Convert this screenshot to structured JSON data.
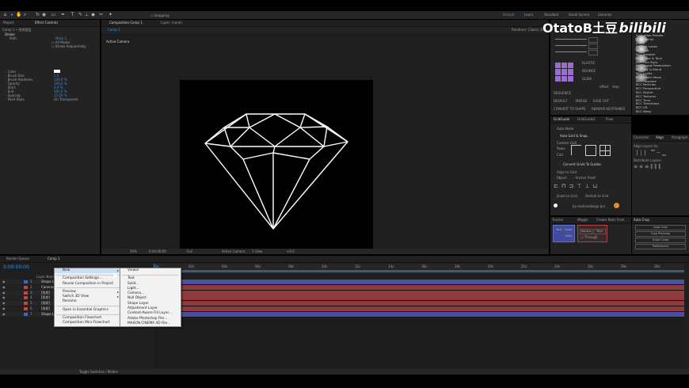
{
  "toolbar": {
    "snapping_label": "Snapping",
    "workspaces": [
      "Default",
      "Learn",
      "Standard",
      "Small Screen",
      "Libraries"
    ]
  },
  "project_panel": {
    "tab_project": "Project",
    "tab_effect_controls": "Effect Controls",
    "comp_label": "Comp 1 • 形状图层",
    "effect_name": "Stroke",
    "paint_label": "Path",
    "mask_value": "Mask 1",
    "all_masks": "All Masks",
    "stroke_sequentially": "Stroke Sequentially",
    "props": [
      {
        "name": "Color",
        "value": ""
      },
      {
        "name": "Brush Size",
        "value": "2.0"
      },
      {
        "name": "Brush Hardness",
        "value": "100.0 %"
      },
      {
        "name": "Opacity",
        "value": "100.0 %"
      },
      {
        "name": "Start",
        "value": "0.0 %"
      },
      {
        "name": "End",
        "value": "100.0 %"
      },
      {
        "name": "Spacing",
        "value": "15.00 %"
      },
      {
        "name": "Paint Style",
        "value": "On Transparent"
      }
    ]
  },
  "viewer": {
    "tab_comp": "Composition Comp 1",
    "layer_label": "Layer: (none)",
    "sub_tab": "Comp 1",
    "active_camera": "Active Camera",
    "renderer_label": "Renderer:",
    "renderer_value": "Classic 3D",
    "zoom": "50%",
    "timecode": "0:00:00:00",
    "quality": "Full",
    "view": "Active Camera",
    "views": "1 View",
    "offset": "+0.0"
  },
  "watermark": {
    "text": "OtatoB土豆",
    "logo": "bilibili"
  },
  "right_panel": {
    "effects_list": [
      "Animation Presets",
      "3D Channel",
      "Audio",
      "BCC Art Looks",
      "BCC Blur",
      "BCC Browser",
      "BCC Color & Tone",
      "BCC Film Style",
      "BCC Image Restoration",
      "BCC Key & Blend",
      "BCC Lights",
      "BCC Match Move",
      "BCC Obsolete",
      "BCC Particles",
      "BCC Perspective",
      "BCC Stylize",
      "BCC Textures",
      "BCC Time",
      "BCC Transitions",
      "BCC VR",
      "BCC Warp"
    ],
    "tool_labels": {
      "elastic": "ELASTIC",
      "bounce": "BOUNCE",
      "glide": "GLIDE",
      "sequence": "SEQUENCE",
      "default": "DEFAULT",
      "merge": "MERGE",
      "ease_in": "EASE IN",
      "ease_out": "EASE OUT",
      "convert": "CONVERT TO SHAPE",
      "remove": "REMOVE KEYFRAMES",
      "offset": "offset",
      "step": "step"
    },
    "grid_tabs": [
      "GridGuide",
      "GridGuide2",
      "Flow"
    ],
    "grid": {
      "auto_mode": "Auto Mode",
      "auto_grid": "Auto Grid & Snap",
      "custom_grid": "Custom Grid",
      "rows": "Rows",
      "cols": "Cols",
      "convert_grids": "Convert Grids To Guides",
      "align_to_grid": "Align to Grid",
      "object_label": "Object",
      "anchor_point": "Anchor Point",
      "scale_to_grid": "Scale to Grid",
      "stretch_to_grid": "Stretch to Grid",
      "by": "by motiondesign.pro"
    },
    "character_tabs": [
      "Character",
      "Align",
      "Paragraph"
    ],
    "align_label": "Align Layers to:",
    "distribute_label": "Distribute Layers:",
    "tracker_tabs": [
      "Tracker",
      "Wiggle",
      "Create Nulls From"
    ],
    "tracker_buttons": [
      "Null",
      "Layer",
      "Solid",
      "Source",
      "Find"
    ],
    "through_label": "Through",
    "auto_crop_tab": "Auto Crop",
    "auto_crop_buttons": [
      "Auto Crop",
      "Crop Precomp",
      "Scale Comp",
      "Preferences"
    ]
  },
  "timeline": {
    "render_queue_tab": "Render Queue",
    "comp_tab": "Comp 1",
    "timecode": "0:00:00:00",
    "layer_header": "Layer Name",
    "layers": [
      {
        "num": "1",
        "name": "Shape L",
        "color": "#3a6bb8"
      },
      {
        "num": "2",
        "name": "Camera",
        "color": "#b84a4a"
      },
      {
        "num": "3",
        "name": "[形状]",
        "color": "#b84a4a"
      },
      {
        "num": "4",
        "name": "[形状]",
        "color": "#b84a4a"
      },
      {
        "num": "5",
        "name": "[形状]",
        "color": "#b84a4a"
      },
      {
        "num": "6",
        "name": "[形状]",
        "color": "#b84a4a"
      },
      {
        "num": "7",
        "name": "Shape L",
        "color": "#3a6bb8"
      }
    ],
    "ruler_ticks": [
      "0s",
      "02s",
      "04s",
      "06s",
      "08s",
      "10s",
      "12s",
      "14s",
      "16s",
      "18s",
      "20s",
      "22s",
      "24s",
      "26s",
      "28s",
      "30s"
    ],
    "toggle_label": "Toggle Switches / Modes"
  },
  "context_menu": {
    "items": [
      {
        "label": "New",
        "has_sub": true
      },
      {
        "sep": true
      },
      {
        "label": "Composition Settings...",
        "has_sub": false
      },
      {
        "label": "Reveal Composition in Project",
        "has_sub": false
      },
      {
        "sep": true
      },
      {
        "label": "Preview",
        "has_sub": true
      },
      {
        "label": "Switch 3D View",
        "has_sub": true
      },
      {
        "label": "Rename",
        "has_sub": false
      },
      {
        "sep": true
      },
      {
        "label": "Open in Essential Graphics",
        "has_sub": false
      },
      {
        "sep": true
      },
      {
        "label": "Composition Flowchart",
        "has_sub": false
      },
      {
        "label": "Composition Mini-Flowchart",
        "has_sub": false
      }
    ],
    "submenu": [
      "Viewer",
      "Text",
      "Solid...",
      "Light...",
      "Camera...",
      "Null Object",
      "Shape Layer",
      "Adjustment Layer",
      "Content-Aware Fill Layer...",
      "Adobe Photoshop File...",
      "MAXON CINEMA 4D File..."
    ]
  },
  "colors": {
    "accent": "#3a8fe0",
    "panel": "#232323",
    "layer_red": "#8e3a3f",
    "layer_blue": "#4a4fa0"
  }
}
